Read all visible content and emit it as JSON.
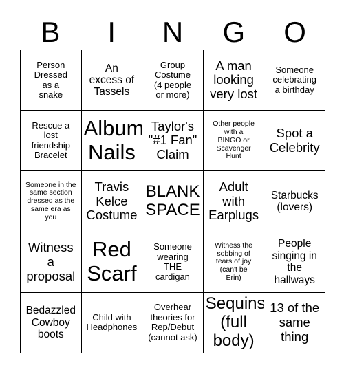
{
  "card": {
    "header_letters": [
      "B",
      "I",
      "N",
      "G",
      "O"
    ],
    "free_space_label": "BLANK SPACE",
    "colors": {
      "background": "#ffffff",
      "text": "#000000",
      "grid_line": "#000000"
    },
    "rows": [
      [
        {
          "text": "Person\nDressed\nas a\nsnake",
          "size": "s"
        },
        {
          "text": "An\nexcess of\nTassels",
          "size": "m"
        },
        {
          "text": "Group\nCostume\n(4 people\nor more)",
          "size": "s"
        },
        {
          "text": "A man\nlooking\nvery lost",
          "size": "l"
        },
        {
          "text": "Someone\ncelebrating\na birthday",
          "size": "s"
        }
      ],
      [
        {
          "text": "Rescue a\nlost\nfriendship\nBracelet",
          "size": "s"
        },
        {
          "text": "Album\nNails",
          "size": "xxl"
        },
        {
          "text": "Taylor's\n\"#1 Fan\"\nClaim",
          "size": "l"
        },
        {
          "text": "Other people\nwith a\nBINGO or\nScavenger\nHunt",
          "size": "xs"
        },
        {
          "text": "Spot a\nCelebrity",
          "size": "l"
        }
      ],
      [
        {
          "text": "Someone in the\nsame section\ndressed as the\nsame era as\nyou",
          "size": "xs"
        },
        {
          "text": "Travis\nKelce\nCostume",
          "size": "l"
        },
        {
          "text": "BLANK\nSPACE",
          "size": "xl"
        },
        {
          "text": "Adult\nwith\nEarplugs",
          "size": "l"
        },
        {
          "text": "Starbucks\n(lovers)",
          "size": "m"
        }
      ],
      [
        {
          "text": "Witness\na\nproposal",
          "size": "l"
        },
        {
          "text": "Red\nScarf",
          "size": "xxl"
        },
        {
          "text": "Someone\nwearing\nTHE\ncardigan",
          "size": "s"
        },
        {
          "text": "Witness the\nsobbing of\ntears of joy\n(can't be\nErin)",
          "size": "xs"
        },
        {
          "text": "People\nsinging in\nthe\nhallways",
          "size": "m"
        }
      ],
      [
        {
          "text": "Bedazzled\nCowboy\nboots",
          "size": "m"
        },
        {
          "text": "Child with\nHeadphones",
          "size": "s"
        },
        {
          "text": "Overhear\ntheories for\nRep/Debut\n(cannot ask)",
          "size": "s"
        },
        {
          "text": "Sequins\n(full\nbody)",
          "size": "xl"
        },
        {
          "text": "13 of the\nsame\nthing",
          "size": "l"
        }
      ]
    ]
  }
}
